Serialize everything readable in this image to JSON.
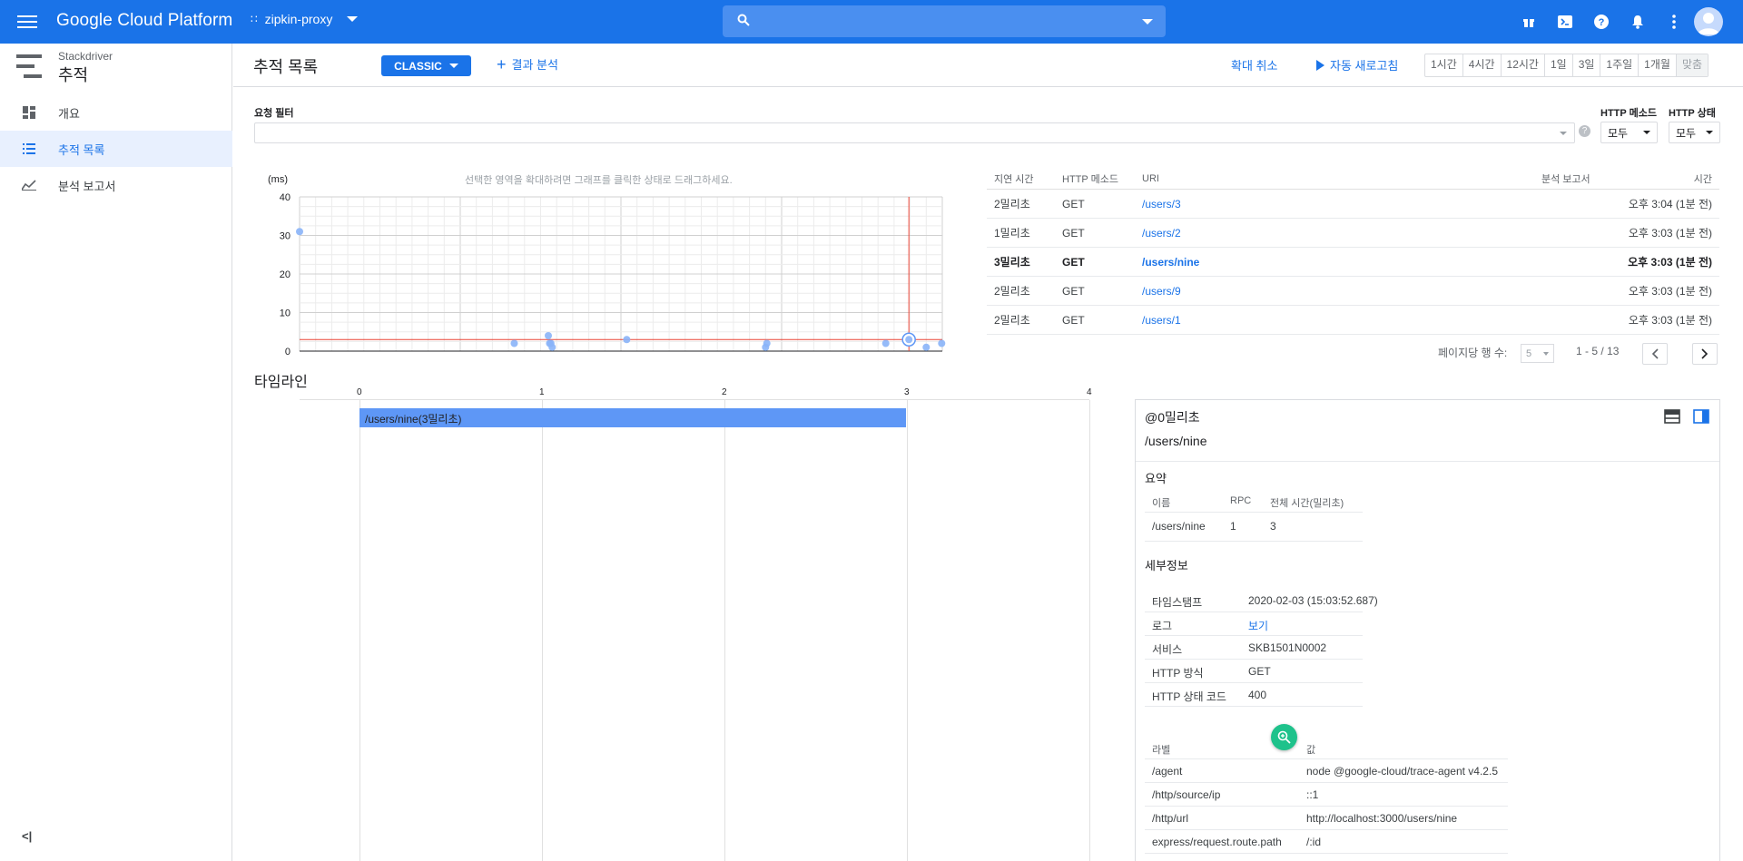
{
  "topbar": {
    "brand": "Google Cloud Platform",
    "project": "zipkin-proxy",
    "search_placeholder": ""
  },
  "sidebar": {
    "product_small": "Stackdriver",
    "product": "추적",
    "items": [
      {
        "label": "개요",
        "icon": "dashboard-icon"
      },
      {
        "label": "추적 목록",
        "icon": "list-icon",
        "active": true
      },
      {
        "label": "분석 보고서",
        "icon": "analytics-icon"
      }
    ],
    "collapse": "<|"
  },
  "header": {
    "title": "추적 목록",
    "classic": "CLASSIC",
    "analyze": "결과 분석",
    "zoom_cancel": "확대 취소",
    "auto_refresh": "자동 새로고침",
    "ranges": [
      "1시간",
      "4시간",
      "12시간",
      "1일",
      "3일",
      "1주일",
      "1개월",
      "맞춤"
    ]
  },
  "filter": {
    "label": "요청 필터",
    "value": "",
    "http_method_label": "HTTP 메소드",
    "http_method_value": "모두",
    "http_status_label": "HTTP 상태",
    "http_status_value": "모두"
  },
  "chart_data": {
    "type": "scatter",
    "title": "",
    "hint": "선택한 영역을 확대하려면 그래프를 클릭한 상태로 드래그하세요.",
    "ylabel": "(ms)",
    "ylim": [
      0,
      40
    ],
    "yticks": [
      "0",
      "10",
      "20",
      "30",
      "40"
    ],
    "x_relative": [
      0.0,
      0.334,
      0.387,
      0.389,
      0.391,
      0.393,
      0.509,
      0.725,
      0.727,
      0.912,
      0.948,
      0.975,
      0.999
    ],
    "values": [
      31,
      2,
      4,
      2,
      2,
      1,
      3,
      1,
      2,
      2,
      3,
      1,
      2
    ],
    "selected_value": 3,
    "threshold": 3,
    "grid": true
  },
  "table": {
    "headers": {
      "latency": "지연 시간",
      "method": "HTTP 메소드",
      "uri": "URI",
      "analysis": "분석 보고서",
      "time": "시간"
    },
    "rows": [
      {
        "latency": "2밀리초",
        "method": "GET",
        "uri": "/users/3",
        "time": "오후 3:04 (1분 전)",
        "bold": false
      },
      {
        "latency": "1밀리초",
        "method": "GET",
        "uri": "/users/2",
        "time": "오후 3:03 (1분 전)",
        "bold": false
      },
      {
        "latency": "3밀리초",
        "method": "GET",
        "uri": "/users/nine",
        "time": "오후 3:03 (1분 전)",
        "bold": true
      },
      {
        "latency": "2밀리초",
        "method": "GET",
        "uri": "/users/9",
        "time": "오후 3:03 (1분 전)",
        "bold": false
      },
      {
        "latency": "2밀리초",
        "method": "GET",
        "uri": "/users/1",
        "time": "오후 3:03 (1분 전)",
        "bold": false
      }
    ],
    "rows_per_page_label": "페이지당 행 수:",
    "rows_per_page": "5",
    "range": "1 - 5 / 13"
  },
  "timeline": {
    "title": "타임라인",
    "ticks": [
      "0",
      "1",
      "2",
      "3",
      "4"
    ],
    "bar_label": "/users/nine(3밀리초)"
  },
  "detail": {
    "offset": "@0밀리초",
    "path": "/users/nine",
    "summary_title": "요약",
    "summary_headers": [
      "이름",
      "RPC",
      "전체 시간(밀리초)"
    ],
    "summary_row": [
      "/users/nine",
      "1",
      "3"
    ],
    "details_title": "세부정보",
    "details": [
      {
        "k": "타임스탬프",
        "v": "2020-02-03 (15:03:52.687)"
      },
      {
        "k": "로그",
        "v": "보기",
        "link": true
      },
      {
        "k": "서비스",
        "v": "SKB1501N0002"
      },
      {
        "k": "HTTP 방식",
        "v": "GET"
      },
      {
        "k": "HTTP 상태 코드",
        "v": "400"
      }
    ],
    "labels_headers": [
      "라벨",
      "값"
    ],
    "labels": [
      {
        "k": "/agent",
        "v": "node @google-cloud/trace-agent v4.2.5"
      },
      {
        "k": "/http/source/ip",
        "v": "::1"
      },
      {
        "k": "/http/url",
        "v": "http://localhost:3000/users/nine"
      },
      {
        "k": "express/request.route.path",
        "v": "/:id"
      }
    ]
  }
}
